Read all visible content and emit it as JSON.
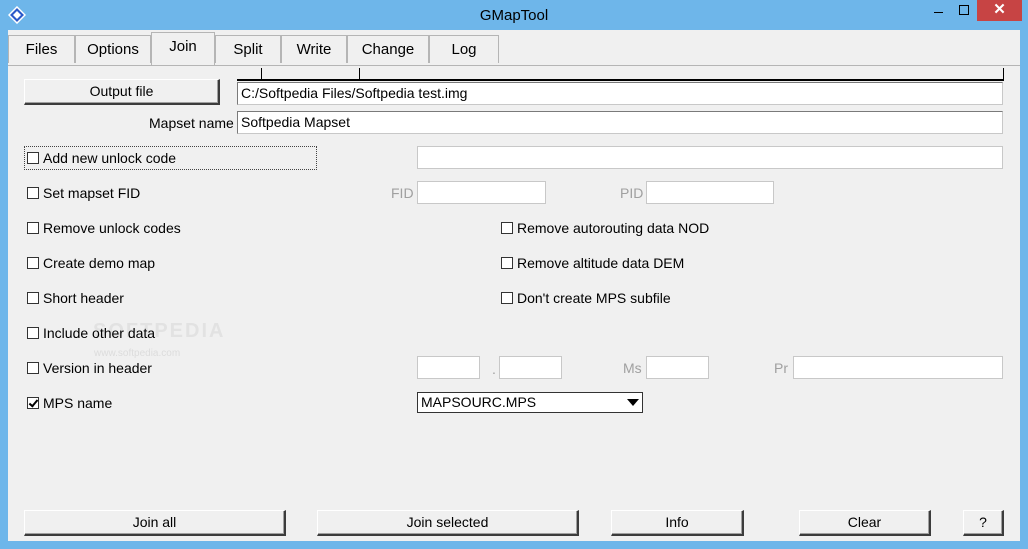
{
  "window": {
    "title": "GMapTool",
    "close_glyph": "✕",
    "colors": {
      "title_bar": "#6eb6ea",
      "close_button": "#c74444",
      "client": "#f0f0f0"
    }
  },
  "tabs": [
    {
      "label": "Files",
      "active": false
    },
    {
      "label": "Options",
      "active": false
    },
    {
      "label": "Join",
      "active": true
    },
    {
      "label": "Split",
      "active": false
    },
    {
      "label": "Write",
      "active": false
    },
    {
      "label": "Change",
      "active": false
    },
    {
      "label": "Log",
      "active": false
    }
  ],
  "join": {
    "output_file_button": "Output file",
    "output_file_value": "C:/Softpedia Files/Softpedia test.img",
    "mapset_name_label": "Mapset name",
    "mapset_name_value": "Softpedia Mapset",
    "add_unlock_code": {
      "label": "Add new unlock code",
      "checked": false,
      "value": ""
    },
    "set_mapset_fid": {
      "label": "Set mapset FID",
      "checked": false
    },
    "fid_label": "FID",
    "fid_value": "",
    "pid_label": "PID",
    "pid_value": "",
    "remove_unlock_codes": {
      "label": "Remove unlock codes",
      "checked": false
    },
    "remove_autorouting": {
      "label": "Remove autorouting data NOD",
      "checked": false
    },
    "create_demo_map": {
      "label": "Create demo map",
      "checked": false
    },
    "remove_altitude": {
      "label": "Remove altitude data DEM",
      "checked": false
    },
    "short_header": {
      "label": "Short header",
      "checked": false
    },
    "dont_create_mps": {
      "label": "Don't create MPS subfile",
      "checked": false
    },
    "include_other_data": {
      "label": "Include other data",
      "checked": false
    },
    "version_in_header": {
      "label": "Version in header",
      "checked": false
    },
    "version_dot": ".",
    "ms_label": "Ms",
    "pr_label": "Pr",
    "mps_name": {
      "label": "MPS name",
      "checked": true
    },
    "mps_select_value": "MAPSOURC.MPS"
  },
  "watermark": {
    "text": "SOFTPEDIA",
    "sub": "www.softpedia.com"
  },
  "bottom_buttons": {
    "join_all": "Join all",
    "join_selected": "Join selected",
    "info": "Info",
    "clear": "Clear",
    "help": "?"
  }
}
